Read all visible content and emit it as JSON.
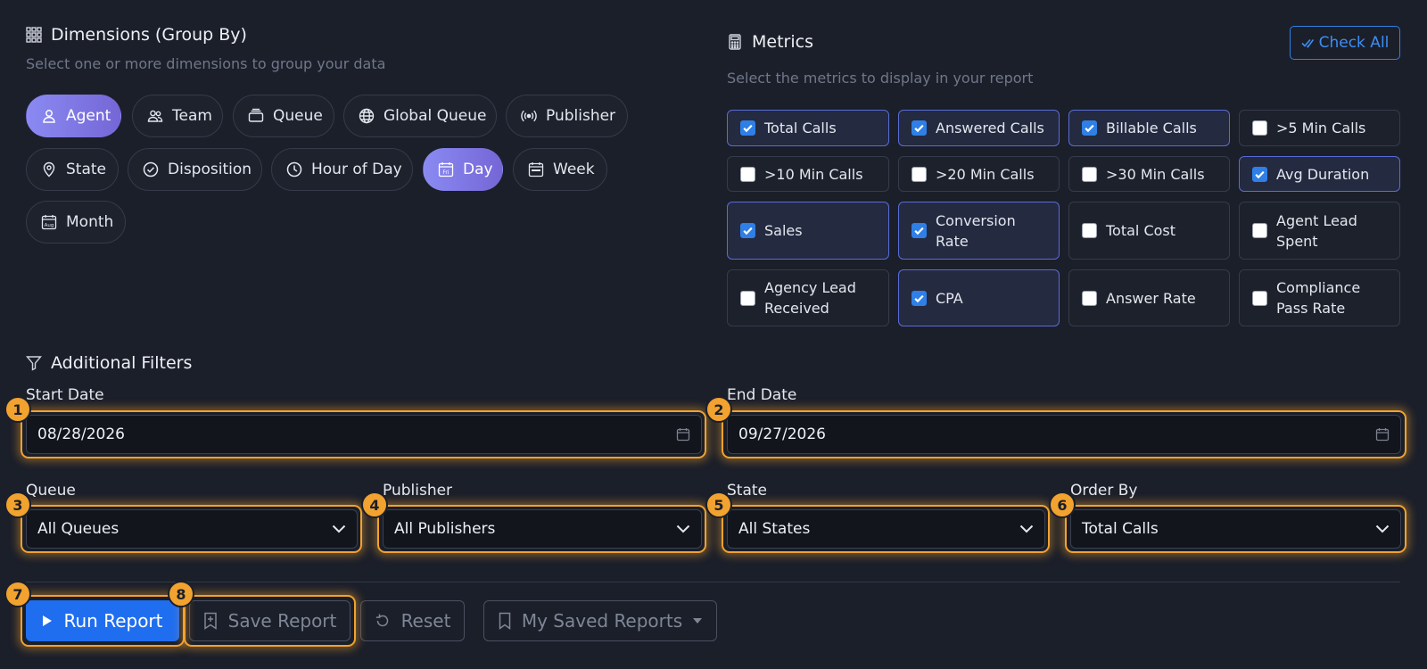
{
  "dimensions": {
    "title": "Dimensions (Group By)",
    "subtitle": "Select one or more dimensions to group your data",
    "chips": [
      {
        "label": "Agent",
        "icon": "user-icon",
        "active": true
      },
      {
        "label": "Team",
        "icon": "users-icon",
        "active": false
      },
      {
        "label": "Queue",
        "icon": "inbox-stack-icon",
        "active": false
      },
      {
        "label": "Global Queue",
        "icon": "globe-icon",
        "active": false
      },
      {
        "label": "Publisher",
        "icon": "broadcast-icon",
        "active": false
      },
      {
        "label": "State",
        "icon": "map-pin-icon",
        "active": false
      },
      {
        "label": "Disposition",
        "icon": "check-circle-icon",
        "active": false
      },
      {
        "label": "Hour of Day",
        "icon": "clock-icon",
        "active": false
      },
      {
        "label": "Day",
        "icon": "calendar-day-icon",
        "active": true
      },
      {
        "label": "Week",
        "icon": "calendar-week-icon",
        "active": false
      },
      {
        "label": "Month",
        "icon": "calendar-month-icon",
        "active": false
      }
    ]
  },
  "metrics": {
    "title": "Metrics",
    "subtitle": "Select the metrics to display in your report",
    "check_all_label": "Check All",
    "items": [
      {
        "label": "Total Calls",
        "checked": true
      },
      {
        "label": "Answered Calls",
        "checked": true
      },
      {
        "label": "Billable Calls",
        "checked": true
      },
      {
        "label": ">5 Min Calls",
        "checked": false
      },
      {
        "label": ">10 Min Calls",
        "checked": false
      },
      {
        "label": ">20 Min Calls",
        "checked": false
      },
      {
        "label": ">30 Min Calls",
        "checked": false
      },
      {
        "label": "Avg Duration",
        "checked": true
      },
      {
        "label": "Sales",
        "checked": true
      },
      {
        "label": "Conversion Rate",
        "checked": true
      },
      {
        "label": "Total Cost",
        "checked": false
      },
      {
        "label": "Agent Lead Spent",
        "checked": false
      },
      {
        "label": "Agency Lead Received",
        "checked": false
      },
      {
        "label": "CPA",
        "checked": true
      },
      {
        "label": "Answer Rate",
        "checked": false
      },
      {
        "label": "Compliance Pass Rate",
        "checked": false
      }
    ]
  },
  "filters": {
    "title": "Additional Filters",
    "start_date": {
      "label": "Start Date",
      "value": "08/28/2026"
    },
    "end_date": {
      "label": "End Date",
      "value": "09/27/2026"
    },
    "queue": {
      "label": "Queue",
      "value": "All Queues"
    },
    "publisher": {
      "label": "Publisher",
      "value": "All Publishers"
    },
    "state": {
      "label": "State",
      "value": "All States"
    },
    "order_by": {
      "label": "Order By",
      "value": "Total Calls"
    }
  },
  "actions": {
    "run_label": "Run Report",
    "save_label": "Save Report",
    "reset_label": "Reset",
    "saved_label": "My Saved Reports"
  },
  "badges": [
    "1",
    "2",
    "3",
    "4",
    "5",
    "6",
    "7",
    "8"
  ],
  "colors": {
    "background": "#1b1f2a",
    "accent": "#1f6ef0",
    "chip_active": "#8a8af2",
    "highlight": "#f2a22e"
  }
}
